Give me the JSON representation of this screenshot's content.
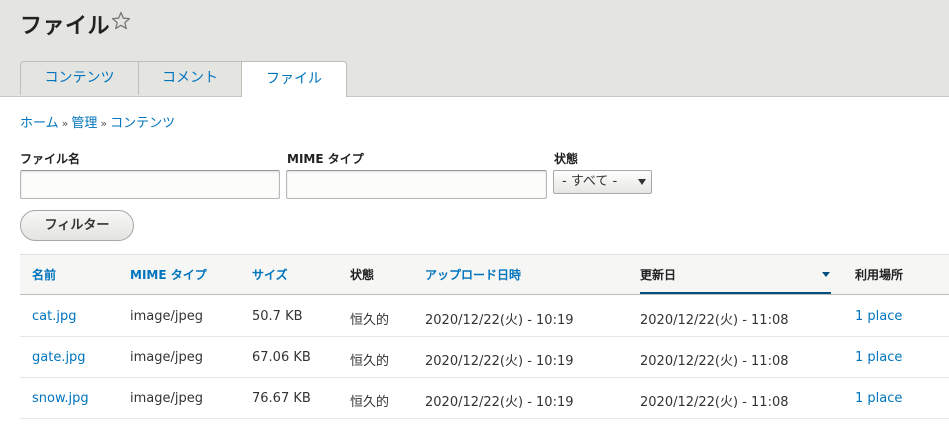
{
  "header": {
    "title": "ファイル",
    "tabs": [
      {
        "label": "コンテンツ"
      },
      {
        "label": "コメント"
      },
      {
        "label": "ファイル"
      }
    ]
  },
  "breadcrumb": {
    "items": [
      "ホーム",
      "管理",
      "コンテンツ"
    ],
    "separator": "»"
  },
  "filters": {
    "filename_label": "ファイル名",
    "filename_value": "",
    "mime_label": "MIME タイプ",
    "mime_value": "",
    "status_label": "状態",
    "status_selected": "- すべて -",
    "submit_label": "フィルター"
  },
  "table": {
    "columns": [
      "名前",
      "MIME タイプ",
      "サイズ",
      "状態",
      "アップロード日時",
      "更新日",
      "利用場所"
    ],
    "rows": [
      {
        "name": "cat.jpg",
        "mime": "image/jpeg",
        "size": "50.7 KB",
        "status": "恒久的",
        "uploaded": "2020/12/22(火) - 10:19",
        "changed": "2020/12/22(火) - 11:08",
        "usage": "1 place"
      },
      {
        "name": "gate.jpg",
        "mime": "image/jpeg",
        "size": "67.06 KB",
        "status": "恒久的",
        "uploaded": "2020/12/22(火) - 10:19",
        "changed": "2020/12/22(火) - 11:08",
        "usage": "1 place"
      },
      {
        "name": "snow.jpg",
        "mime": "image/jpeg",
        "size": "76.67 KB",
        "status": "恒久的",
        "uploaded": "2020/12/22(火) - 10:19",
        "changed": "2020/12/22(火) - 11:08",
        "usage": "1 place"
      }
    ]
  },
  "colors": {
    "link": "#0074bd",
    "header_bg": "#e4e4e1",
    "sort_indicator": "#004f80"
  },
  "icons": {
    "favorite": "star-outline-icon",
    "select_caret": "caret-down-icon",
    "sort": "sort-desc-icon"
  }
}
